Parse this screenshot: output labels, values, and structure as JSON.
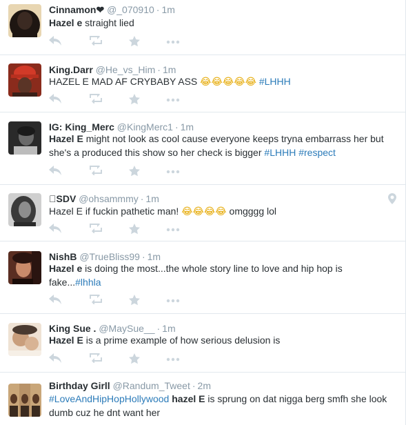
{
  "tweets": [
    {
      "fullname": "Cinnamon❤",
      "handle": "@_070910",
      "time": "1m",
      "segments": [
        {
          "t": "Hazel e",
          "s": "b"
        },
        {
          "t": " straight lied",
          "s": ""
        }
      ],
      "avatar_colors": [
        "#e8d6b2",
        "#1e1612",
        "#3b2a22"
      ]
    },
    {
      "fullname": "King.Darr",
      "handle": "@He_vs_Him",
      "time": "1m",
      "segments": [
        {
          "t": "HAZEL E MAD AF CRYBABY ASS ",
          "s": ""
        },
        {
          "t": "😂😂😂😂😂",
          "s": "emoji"
        },
        {
          "t": " ",
          "s": ""
        },
        {
          "t": "#LHHH",
          "s": "tag"
        }
      ],
      "avatar_colors": [
        "#8a2b1c",
        "#d23a28",
        "#5a3426"
      ]
    },
    {
      "fullname": "IG: King_Merc",
      "handle": "@KingMerc1",
      "time": "1m",
      "segments": [
        {
          "t": "Hazel E",
          "s": "b"
        },
        {
          "t": " might not look as cool cause everyone keeps tryna embarrass her but she's a produced this show so her check is bigger ",
          "s": ""
        },
        {
          "t": "#LHHH",
          "s": "tag"
        },
        {
          "t": " ",
          "s": ""
        },
        {
          "t": "#respect",
          "s": "tag"
        }
      ],
      "avatar_colors": [
        "#2a2a2a",
        "#6a6a6a",
        "#bcbcbc"
      ]
    },
    {
      "fullname": "󾠠SDV",
      "handle": "@ohsammmy",
      "time": "1m",
      "segments": [
        {
          "t": "Hazel E if fuckin pathetic man! ",
          "s": ""
        },
        {
          "t": "😂😂😂😂",
          "s": "emoji"
        },
        {
          "t": " omgggg lol",
          "s": ""
        }
      ],
      "avatar_colors": [
        "#cfcfcf",
        "#3a3a3a",
        "#8e8e8e"
      ]
    },
    {
      "fullname": "NishB",
      "handle": "@TrueBliss99",
      "time": "1m",
      "segments": [
        {
          "t": "Hazel e",
          "s": "b"
        },
        {
          "t": " is doing the most...the whole story line to love and hip hop is fake...",
          "s": ""
        },
        {
          "t": "#lhhla",
          "s": "tag"
        }
      ],
      "avatar_colors": [
        "#5a2e22",
        "#c98a6a",
        "#2a1410"
      ]
    },
    {
      "fullname": "King Sue .",
      "handle": "@MaySue__",
      "time": "1m",
      "segments": [
        {
          "t": "Hazel E",
          "s": "b"
        },
        {
          "t": " is a prime example of how serious delusion is",
          "s": ""
        }
      ],
      "avatar_colors": [
        "#efe2d4",
        "#c99e7c",
        "#4a3a30"
      ]
    },
    {
      "fullname": "Birthday Girll",
      "handle": "@Randum_Tweet",
      "time": "2m",
      "segments": [
        {
          "t": "#LoveAndHipHopHollywood",
          "s": "tag"
        },
        {
          "t": "  ",
          "s": ""
        },
        {
          "t": "hazel E",
          "s": "b"
        },
        {
          "t": " is sprung on dat nigga berg smfh she look dumb cuz he dnt want her",
          "s": ""
        }
      ],
      "avatar_colors": [
        "#c9a679",
        "#5a3a26",
        "#e3cfb0"
      ]
    }
  ],
  "icons": {
    "reply": "reply-icon",
    "retweet": "retweet-icon",
    "favorite": "favorite-star-icon",
    "more": "more-dots-icon",
    "location": "location-pin-icon"
  },
  "colors": {
    "hashtag": "#2b7bb9",
    "muted": "#8899a6",
    "action_icon": "#ccd6dd",
    "divider": "#e1e8ed"
  }
}
